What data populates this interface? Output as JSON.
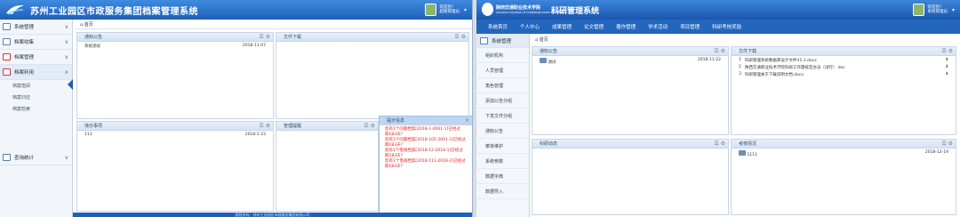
{
  "left": {
    "header_title": "苏州工业园区市政服务集团档案管理系统",
    "user": {
      "line1": "欢迎您！",
      "line2": "超级管理员"
    },
    "sidebar": {
      "items": [
        {
          "label": "系统管理"
        },
        {
          "label": "档案收集"
        },
        {
          "label": "档案管理"
        },
        {
          "label": "档案利用"
        }
      ],
      "subitems": [
        "档案借阅",
        "档案归还",
        "档案检索"
      ],
      "stats": {
        "label": "查询统计"
      }
    },
    "breadcrumb": "首页",
    "panels": {
      "notice": {
        "title": "通知公告",
        "row": {
          "text": "系统测试",
          "date": "2018-11-07"
        }
      },
      "download": {
        "title": "文件下载"
      },
      "todo": {
        "title": "待办事项",
        "row": {
          "text": "111",
          "date": "2018-1-23"
        }
      },
      "manage": {
        "title": "管理提醒"
      },
      "alert": {
        "title": "提示信息",
        "lines": [
          "您有1个问题档案[2018-1-0061-1]已经过",
          "期183天?",
          "您有1个问题档案[2018-105-2001-1]已经过",
          "期183天?",
          "您有1个借阅档案[2018-12-2018-1]已经过",
          "期183天?",
          "您有1个借阅档案[2018-111-2018-2]已经过",
          "期183天?"
        ]
      }
    },
    "footer": "版权所有：苏州工业园区市政服务集团有限公司"
  },
  "right": {
    "logo_cn": "陕西交通职业技术学院",
    "logo_en": "SHAANXI COLLEGE OF COMMUNICATION TECHNOLOGY",
    "title": "科研管理系统",
    "user": {
      "line1": "欢迎您！",
      "line2": "系统管理员"
    },
    "nav": [
      "系统首页",
      "个人中心",
      "成果管理",
      "论文管理",
      "著作管理",
      "学术活动",
      "项目管理",
      "科研考核奖励"
    ],
    "sidebar": {
      "head": "系统管理",
      "items": [
        "组织机构",
        "人员管理",
        "角色管理",
        "添加公告分组",
        "下发文件分组",
        "通知公告",
        "菜单维护",
        "系统参数",
        "数据字典",
        "数据导入"
      ]
    },
    "breadcrumb": "首页",
    "panels": {
      "notice": {
        "title": "通知公告",
        "row": {
          "text": "测试",
          "date": "2018-11-22"
        }
      },
      "files": {
        "title": "文件下载",
        "rows": [
          {
            "num": "1",
            "text": "科研管理系统数据库设计文件V1.1.docx"
          },
          {
            "num": "2",
            "text": "陕西交通职业技术学院科研工作量核定办法（试行）.doc"
          },
          {
            "num": "3",
            "text": "科研管理关于下载说明文档.docx"
          }
        ]
      },
      "research": {
        "title": "科研动态"
      },
      "assess": {
        "title": "考核情况",
        "row": {
          "text": "1111",
          "date": "2018-12-19"
        }
      }
    }
  }
}
